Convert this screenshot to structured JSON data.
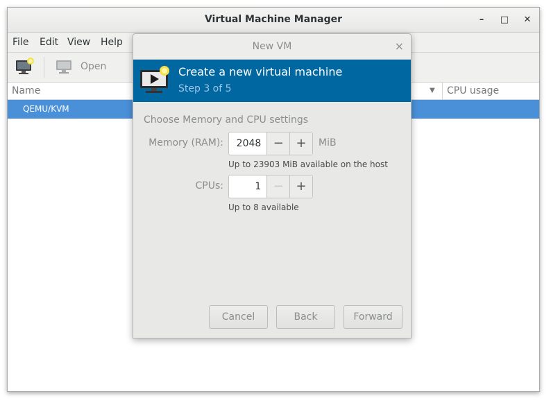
{
  "window": {
    "title": "Virtual Machine Manager",
    "controls": {
      "minimize": "–",
      "maximize": "□",
      "close": "✕"
    }
  },
  "menubar": {
    "items": [
      "File",
      "Edit",
      "View",
      "Help"
    ]
  },
  "toolbar": {
    "open_label": "Open",
    "new_vm_icon": "new-vm-icon",
    "open_icon": "monitor-icon"
  },
  "table": {
    "columns": [
      "Name",
      "CPU usage"
    ],
    "rows": [
      {
        "name": "QEMU/KVM"
      }
    ]
  },
  "dialog": {
    "title": "New VM",
    "close": "×",
    "header": {
      "title": "Create a new virtual machine",
      "step": "Step 3 of 5"
    },
    "section_title": "Choose Memory and CPU settings",
    "memory": {
      "label": "Memory (RAM):",
      "value": "2048",
      "unit": "MiB",
      "hint": "Up to 23903 MiB available on the host",
      "minus": "−",
      "plus": "+"
    },
    "cpus": {
      "label": "CPUs:",
      "value": "1",
      "hint": "Up to 8 available",
      "minus": "−",
      "plus": "+"
    },
    "buttons": {
      "cancel": "Cancel",
      "back": "Back",
      "forward": "Forward"
    }
  },
  "colors": {
    "selection": "#4a90d9",
    "header_bg": "#0067a0",
    "step_text": "#9fc6e6"
  }
}
